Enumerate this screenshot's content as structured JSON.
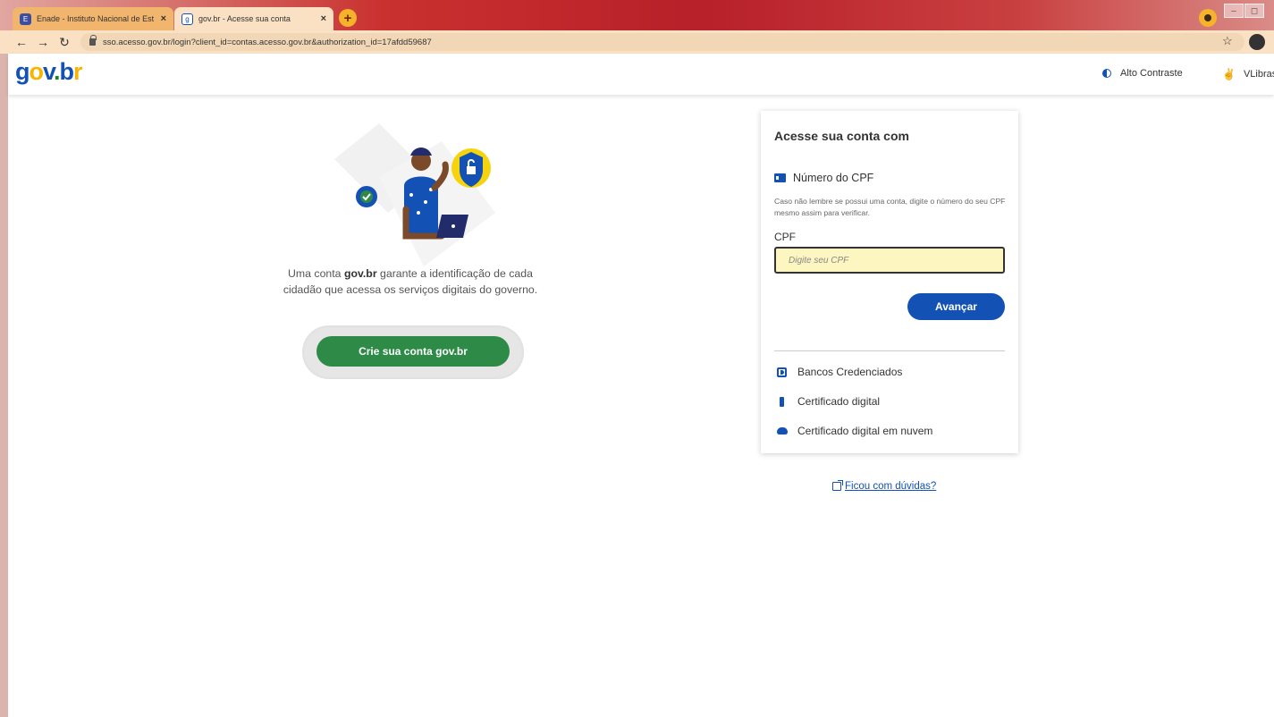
{
  "browser": {
    "tabs": [
      {
        "title": "Enade - Instituto Nacional de Est",
        "active": false
      },
      {
        "title": "gov.br - Acesse sua conta",
        "active": true
      }
    ],
    "url": "sso.acesso.gov.br/login?client_id=contas.acesso.gov.br&authorization_id=17afdd59687",
    "tab_close": "×",
    "new_tab": "+"
  },
  "header": {
    "logo": {
      "g": "g",
      "o": "o",
      "v": "v",
      "dot": ".",
      "b": "b",
      "r": "r"
    },
    "links": [
      "Alto Contraste",
      "VLibras"
    ]
  },
  "hero": {
    "text_before": "Uma conta ",
    "text_bold": "gov.br",
    "text_after": " garante a identificação de cada cidadão que acessa os serviços digitais do governo.",
    "create_button": "Crie sua conta gov.br"
  },
  "login": {
    "title": "Acesse sua conta com",
    "cpf_option": "Número do CPF",
    "hint": "Caso não lembre se possui uma conta, digite o número do seu CPF mesmo assim para verificar.",
    "cpf_label": "CPF",
    "cpf_placeholder": "Digite seu CPF",
    "next_button": "Avançar",
    "alternatives": [
      "Bancos Credenciados",
      "Certificado digital",
      "Certificado digital em nuvem"
    ]
  },
  "help_link": "Ficou com dúvidas?",
  "colors": {
    "primary": "#1351b4",
    "success": "#2e8b47",
    "accent": "#f7b500",
    "input_bg": "#fdf6c0"
  }
}
